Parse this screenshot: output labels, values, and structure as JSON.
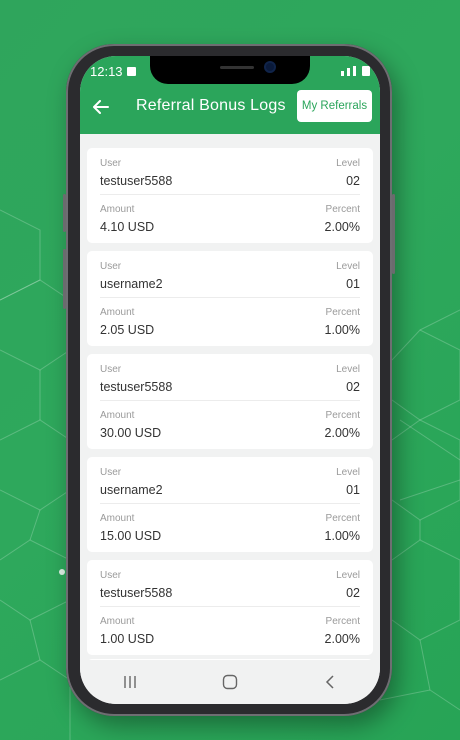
{
  "status": {
    "time": "12:13"
  },
  "header": {
    "title": "Referral Bonus Logs",
    "my_referrals_label": "My Referrals"
  },
  "labels": {
    "user": "User",
    "level": "Level",
    "amount": "Amount",
    "percent": "Percent"
  },
  "logs": [
    {
      "user": "testuser5588",
      "level": "02",
      "amount": "4.10 USD",
      "percent": "2.00%"
    },
    {
      "user": "username2",
      "level": "01",
      "amount": "2.05 USD",
      "percent": "1.00%"
    },
    {
      "user": "testuser5588",
      "level": "02",
      "amount": "30.00 USD",
      "percent": "2.00%"
    },
    {
      "user": "username2",
      "level": "01",
      "amount": "15.00 USD",
      "percent": "1.00%"
    },
    {
      "user": "testuser5588",
      "level": "02",
      "amount": "1.00 USD",
      "percent": "2.00%"
    }
  ],
  "colors": {
    "accent": "#2ba55b",
    "background": "#2ea85c"
  },
  "navbar": {
    "icons": [
      "recent-apps-icon",
      "home-icon",
      "back-icon"
    ]
  }
}
